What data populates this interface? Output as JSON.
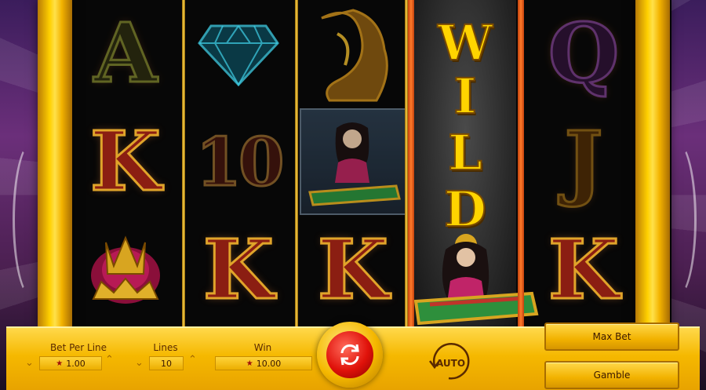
{
  "reels": {
    "col1": [
      "A",
      "K",
      "crown"
    ],
    "col2": [
      "diamond",
      "10",
      "K"
    ],
    "col3": [
      "dragon",
      "genie",
      "K"
    ],
    "col4": [
      "W",
      "I",
      "L",
      "D"
    ],
    "col5": [
      "Q",
      "J",
      "K"
    ]
  },
  "controls": {
    "bet_per_line_label": "Bet Per Line",
    "bet_per_line_value": "1.00",
    "lines_label": "Lines",
    "lines_value": "10",
    "win_label": "Win",
    "win_value": "10.00",
    "auto_label": "AUTO",
    "max_bet_label": "Max Bet",
    "gamble_label": "Gamble"
  },
  "icons": {
    "star": "star-icon",
    "spin": "spin-arrows-icon",
    "auto": "auto-circle-icon",
    "down": "chevron-down-icon",
    "up": "chevron-up-icon"
  },
  "colors": {
    "gold": "#f5b800",
    "spin_red": "#e0120a",
    "frame_gold": "#ffd000",
    "wild_yellow": "#ffd400"
  }
}
